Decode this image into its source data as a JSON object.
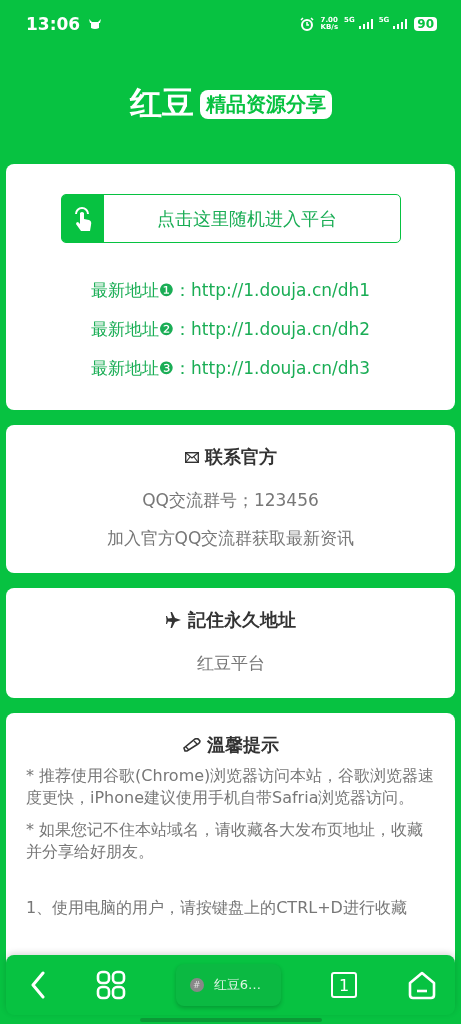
{
  "status_bar": {
    "time": "13:06",
    "net_speed": "7.00",
    "net_unit": "KB/s",
    "sim_1": "5G",
    "sim_2": "5G",
    "battery": "90"
  },
  "header": {
    "title": "红豆",
    "badge": "精品资源分享"
  },
  "entry_card": {
    "button": "点击这里随机进入平台",
    "links": [
      "最新地址❶：http://1.douja.cn/dh1",
      "最新地址❷：http://1.douja.cn/dh2",
      "最新地址❸：http://1.douja.cn/dh3"
    ]
  },
  "info_cards": [
    {
      "kind": "mail",
      "title": "联系官方",
      "lines": [
        "QQ交流群号；123456",
        "加入官方QQ交流群获取最新资讯"
      ]
    },
    {
      "kind": "plane",
      "title": "記住永久地址",
      "lines": [
        "红豆平台"
      ]
    }
  ],
  "tips_card": {
    "title": "溫馨提示",
    "paragraphs": [
      "* 推荐使用谷歌(Chrome)浏览器访问本站，谷歌浏览器速度更快，iPhone建议使用手机自带Safria浏览器访问。",
      "* 如果您记不住本站域名，请收藏各大发布页地址，收藏并分享给好朋友。",
      "1、使用电脑的用户，请按键盘上的CTRL+D进行收藏"
    ]
  },
  "bottom_bar": {
    "tab_title": "红豆6…",
    "tab_icon": "#",
    "tab_count": "1"
  }
}
